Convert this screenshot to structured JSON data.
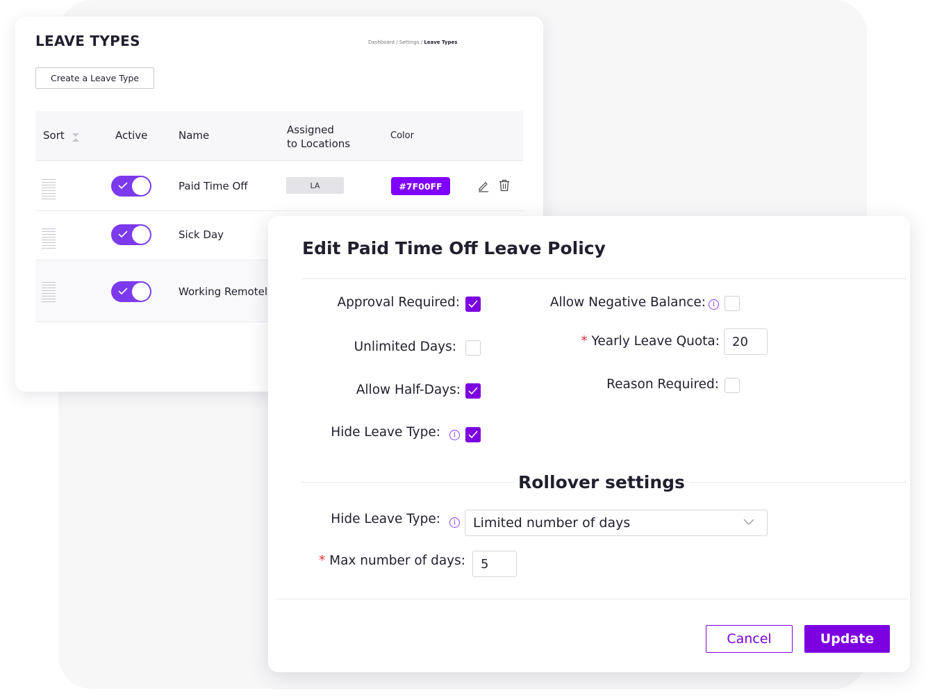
{
  "leave_types": {
    "title": "LEAVE TYPES",
    "breadcrumb": {
      "path": "Dashboard / Settings / ",
      "current": "Leave Types"
    },
    "create_button": "Create a Leave Type",
    "columns": {
      "sort": "Sort",
      "active": "Active",
      "name": "Name",
      "assigned_line1": "Assigned",
      "assigned_line2": "to Locations",
      "color": "Color"
    },
    "rows": [
      {
        "name": "Paid Time Off",
        "active": true,
        "location": "LA",
        "color": "#7F00FF"
      },
      {
        "name": "Sick Day",
        "active": true
      },
      {
        "name": "Working Remotely",
        "active": true
      }
    ]
  },
  "modal": {
    "title": "Edit Paid Time Off Leave Policy",
    "fields": {
      "approval_required": {
        "label": "Approval Required:",
        "checked": true
      },
      "unlimited_days": {
        "label": "Unlimited Days:",
        "checked": false
      },
      "allow_half_days": {
        "label": "Allow Half-Days:",
        "checked": true
      },
      "hide_leave_type": {
        "label": "Hide Leave Type:",
        "checked": true
      },
      "allow_negative_balance": {
        "label": "Allow Negative Balance:",
        "checked": false
      },
      "yearly_leave_quota": {
        "label": "Yearly Leave Quota:",
        "required_mark": "*",
        "value": "20"
      },
      "reason_required": {
        "label": "Reason Required:",
        "checked": false
      }
    },
    "rollover": {
      "title": "Rollover settings",
      "type_label": "Hide Leave Type:",
      "type_value": "Limited number of days",
      "max_days_label": "Max number of days:",
      "max_days_required_mark": "*",
      "max_days_value": "5"
    },
    "cancel_button": "Cancel",
    "update_button": "Update"
  },
  "colors": {
    "accent": "#7c00e0",
    "toggle": "#7c3aed",
    "required": "#e0313b"
  }
}
